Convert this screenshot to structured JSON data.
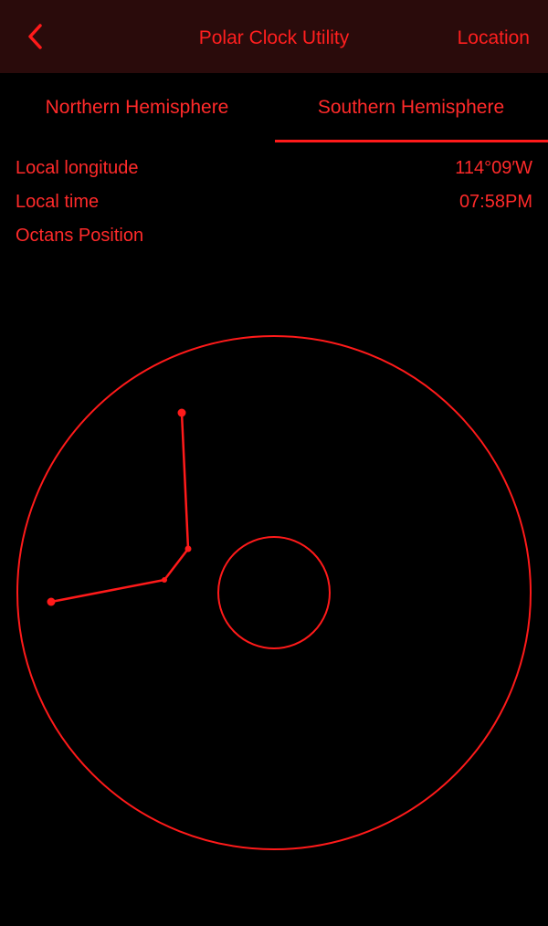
{
  "header": {
    "back_icon": "chevron-left-icon",
    "title": "Polar Clock Utility",
    "location_label": "Location"
  },
  "tabs": [
    {
      "label": "Northern Hemisphere",
      "selected": false
    },
    {
      "label": "Southern Hemisphere",
      "selected": true
    }
  ],
  "info": {
    "longitude_label": "Local longitude",
    "longitude_value": "114°09′W",
    "time_label": "Local time",
    "time_value": "07:58PM",
    "octans_label": "Octans Position"
  },
  "colors": {
    "accent": "#ff1a1a",
    "background": "#000000",
    "navbar_background": "#2a0b0b"
  }
}
